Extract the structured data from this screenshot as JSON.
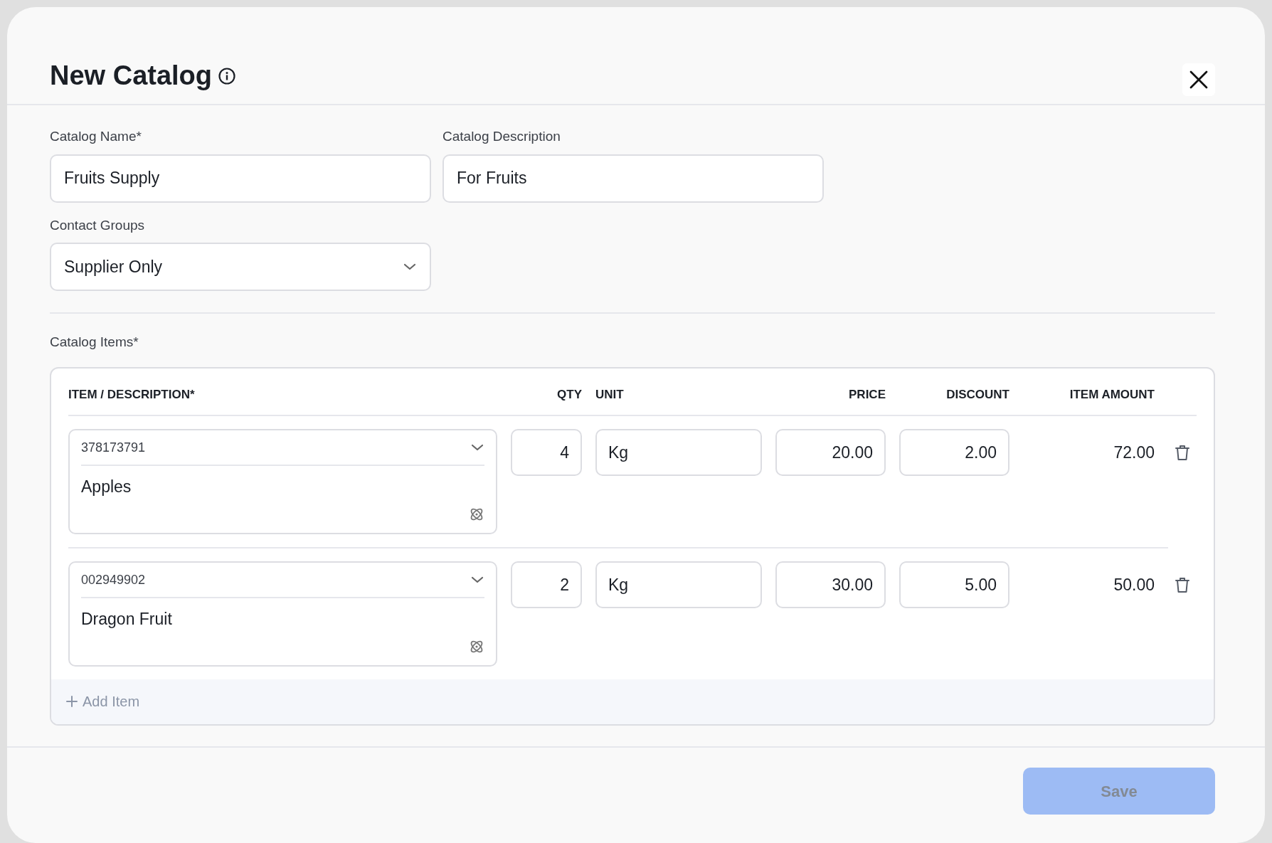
{
  "dialog": {
    "title": "New Catalog",
    "fields": [
      {
        "label": "Catalog Name*",
        "value": "Fruits Supply"
      },
      {
        "label": "Catalog Description",
        "value": "For Fruits"
      }
    ],
    "contact_groups": {
      "label": "Contact Groups",
      "value": "Supplier Only"
    },
    "items_label": "Catalog Items*",
    "table": {
      "columns": [
        "ITEM / DESCRIPTION*",
        "QTY",
        "UNIT",
        "PRICE",
        "DISCOUNT",
        "ITEM AMOUNT"
      ],
      "rows": [
        {
          "code": "378173791",
          "description": "Apples",
          "qty": "4",
          "unit": "Kg",
          "price": "20.00",
          "discount": "2.00",
          "amount": "72.00"
        },
        {
          "code": "002949902",
          "description": "Dragon Fruit",
          "qty": "2",
          "unit": "Kg",
          "price": "30.00",
          "discount": "5.00",
          "amount": "50.00"
        }
      ]
    },
    "add_item": "Add Item",
    "save_button": {
      "label": "Save",
      "disabled": true
    }
  }
}
